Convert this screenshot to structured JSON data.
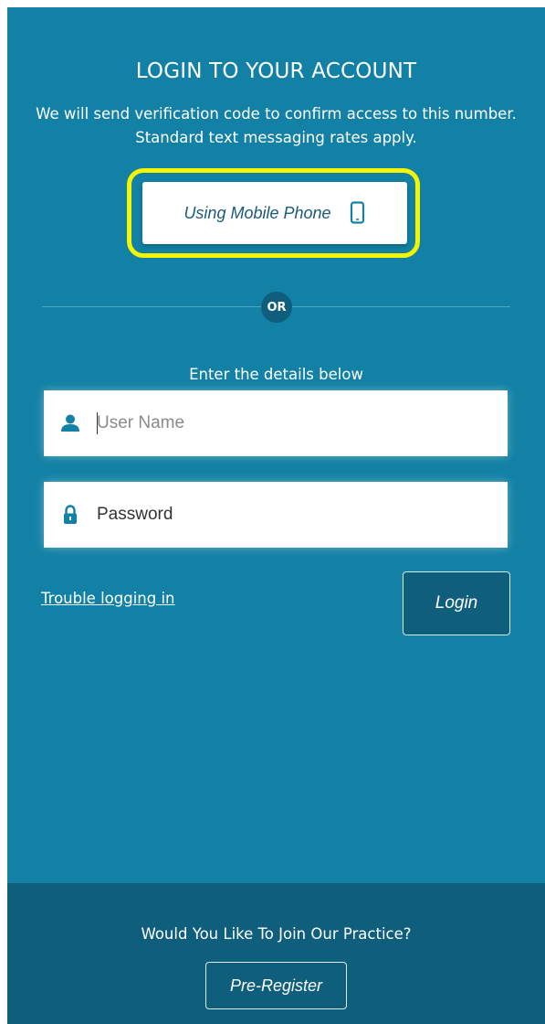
{
  "login": {
    "title": "LOGIN TO YOUR ACCOUNT",
    "subtitle": "We will send verification code to confirm access to this number. Standard text messaging rates apply.",
    "mobile_button_label": "Using Mobile Phone",
    "mobile_icon": "mobile-phone-icon",
    "highlight_color": "#f5f500",
    "or_label": "OR",
    "details_label": "Enter the details below",
    "username": {
      "placeholder": "User Name",
      "value": "",
      "icon": "user-icon"
    },
    "password": {
      "placeholder": "Password",
      "value": "",
      "icon": "lock-icon"
    },
    "trouble_link": "Trouble logging in",
    "login_button": "Login"
  },
  "footer": {
    "prompt": "Would You Like To Join Our Practice?",
    "preregister_button": "Pre-Register"
  },
  "colors": {
    "background": "#1281a5",
    "dark_accent": "#0e5e7c",
    "icon_accent": "#1281a5",
    "button_text": "#1b5a7a"
  }
}
